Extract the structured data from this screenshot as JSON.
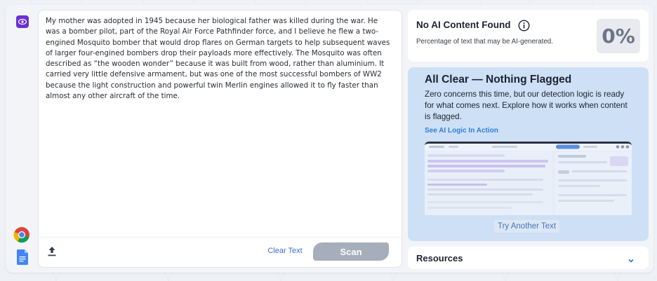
{
  "editor": {
    "text": "My mother was adopted in 1945 because her biological father was killed during the war. He was a bomber pilot, part of the Royal Air Force Pathfinder force, and I believe he flew a two-engined Mosquito bomber that would drop flares on German targets to help subsequent waves of larger four-engined bombers drop their payloads more effectively. The Mosquito was often described as “the wooden wonder” because it was built from wood, rather than aluminium. It carried very little defensive armament, but was one of the most successful bombers of WW2 because the light construction and powerful twin Merlin engines allowed it to fly faster than almost any other aircraft of the time.",
    "clear_label": "Clear Text",
    "scan_label": "Scan"
  },
  "rail": {
    "top_icon": "eye-icon",
    "chrome_icon": "chrome-icon",
    "docs_icon": "google-docs-icon"
  },
  "result": {
    "title": "No AI Content Found",
    "subtitle": "Percentage of text that may be AI-generated.",
    "score": "0%"
  },
  "all_clear": {
    "title": "All Clear — Nothing Flagged",
    "body": "Zero concerns this time, but our detection logic is ready for what comes next. Explore how it works when content is flagged.",
    "link": "See AI Logic In Action",
    "try_label": "Try Another Text"
  },
  "resources": {
    "label": "Resources"
  },
  "colors": {
    "accent": "#6b2fd6",
    "link": "#3b6fd1",
    "panel": "#cde0f5",
    "scan_disabled": "#a6adbb"
  }
}
